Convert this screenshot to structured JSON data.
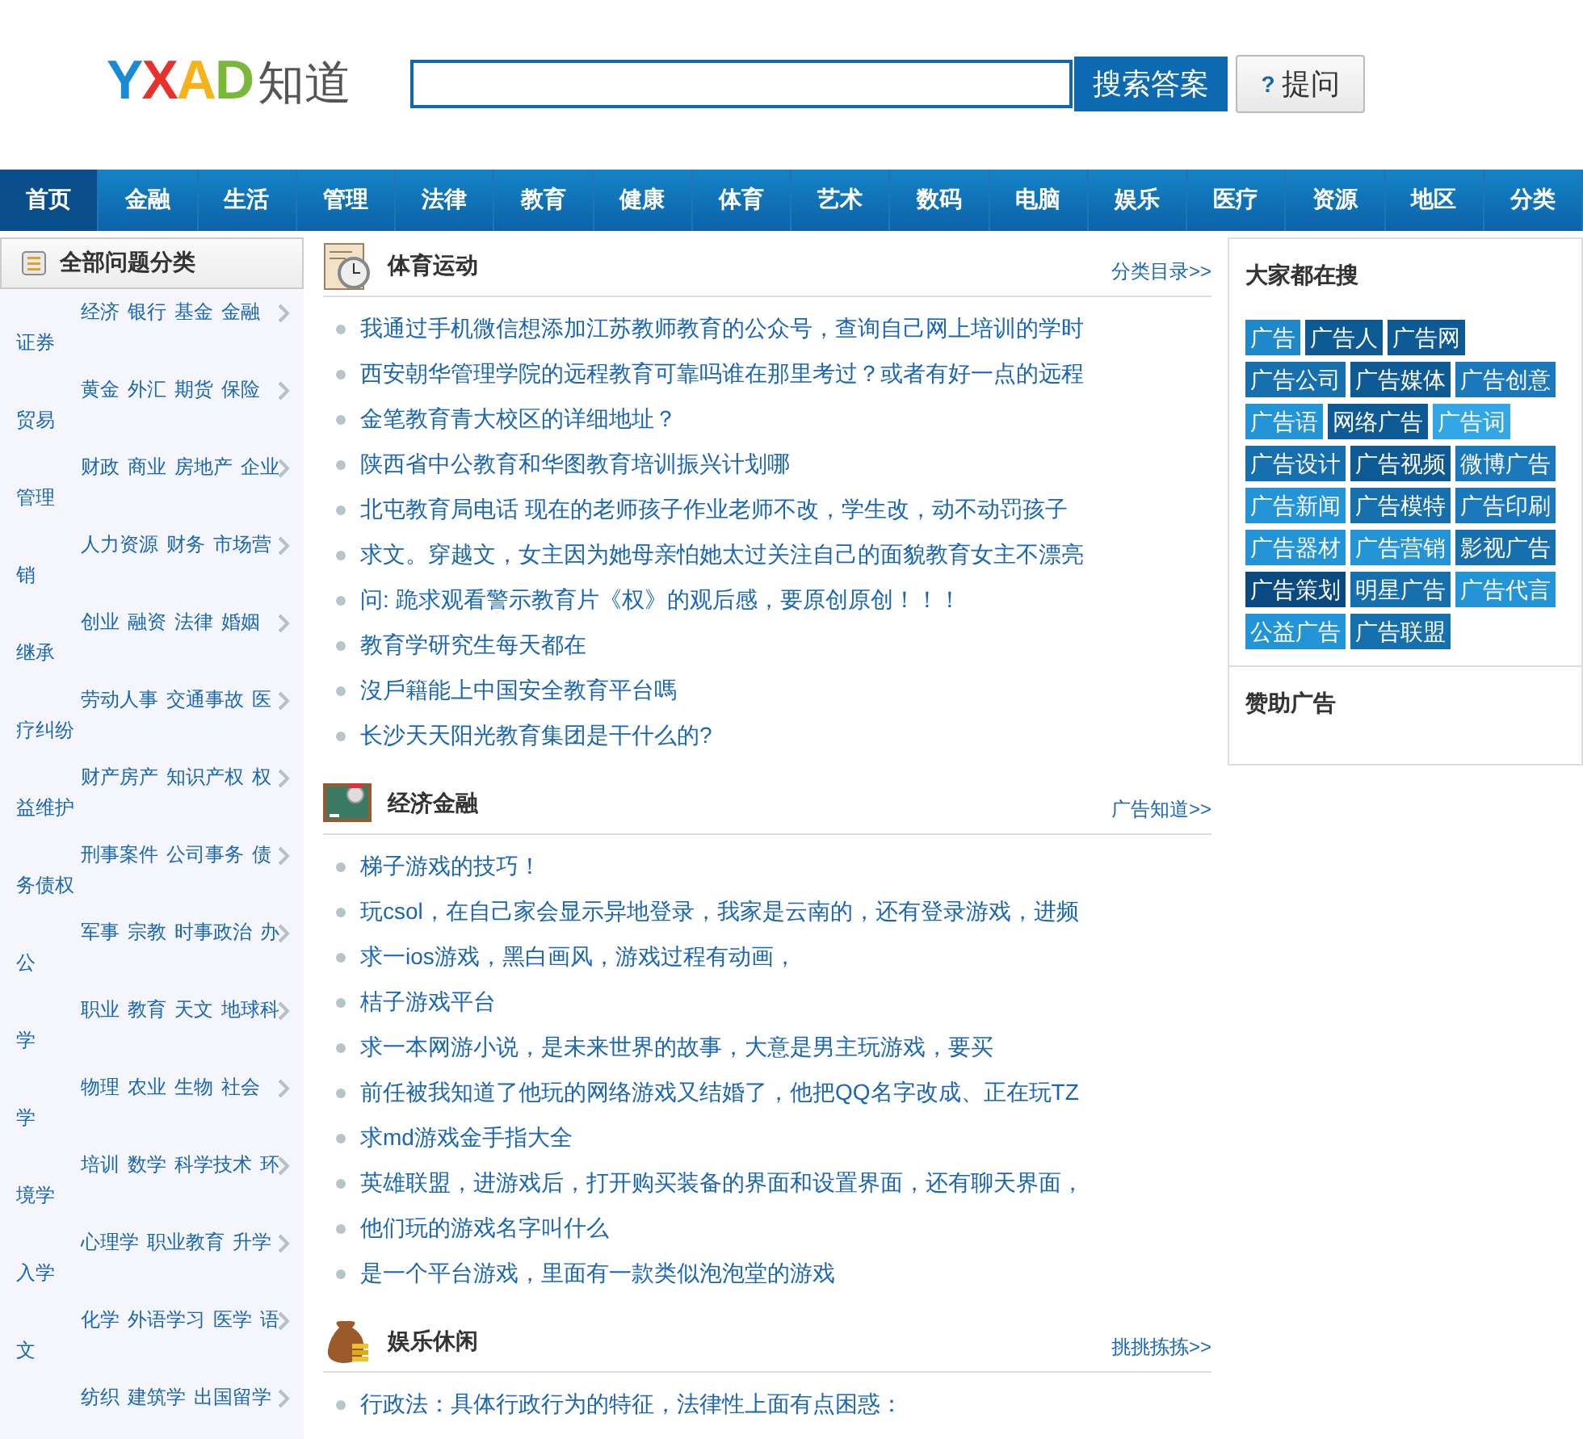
{
  "logo": {
    "letters": [
      {
        "text": "Y",
        "color": "#1b8ad6"
      },
      {
        "text": "X",
        "color": "#e8312b"
      },
      {
        "text": "A",
        "color": "#f6b21a"
      },
      {
        "text": "D",
        "color": "#7ab83a"
      }
    ],
    "suffix": "知道"
  },
  "search": {
    "button": "搜索答案",
    "ask_button": "提问",
    "ask_icon": "?"
  },
  "nav": [
    {
      "label": "首页",
      "selected": true
    },
    {
      "label": "金融",
      "selected": false
    },
    {
      "label": "生活",
      "selected": false
    },
    {
      "label": "管理",
      "selected": false
    },
    {
      "label": "法律",
      "selected": false
    },
    {
      "label": "教育",
      "selected": false
    },
    {
      "label": "健康",
      "selected": false
    },
    {
      "label": "体育",
      "selected": false
    },
    {
      "label": "艺术",
      "selected": false
    },
    {
      "label": "数码",
      "selected": false
    },
    {
      "label": "电脑",
      "selected": false
    },
    {
      "label": "娱乐",
      "selected": false
    },
    {
      "label": "医疗",
      "selected": false
    },
    {
      "label": "资源",
      "selected": false
    },
    {
      "label": "地区",
      "selected": false
    },
    {
      "label": "分类",
      "selected": false
    }
  ],
  "sidebar": {
    "title": "全部问题分类",
    "rows": [
      [
        "经济",
        "银行",
        "基金",
        "金融",
        "证券"
      ],
      [
        "黄金",
        "外汇",
        "期货",
        "保险",
        "贸易"
      ],
      [
        "财政",
        "商业",
        "房地产",
        "企业管理"
      ],
      [
        "人力资源",
        "财务",
        "市场营销"
      ],
      [
        "创业",
        "融资",
        "法律",
        "婚姻",
        "继承"
      ],
      [
        "劳动人事",
        "交通事故",
        "医疗纠纷"
      ],
      [
        "财产房产",
        "知识产权",
        "权益维护"
      ],
      [
        "刑事案件",
        "公司事务",
        "债务债权"
      ],
      [
        "军事",
        "宗教",
        "时事政治",
        "办公"
      ],
      [
        "职业",
        "教育",
        "天文",
        "地球科学"
      ],
      [
        "物理",
        "农业",
        "生物",
        "社会学"
      ],
      [
        "培训",
        "数学",
        "科学技术",
        "环境学"
      ],
      [
        "心理学",
        "职业教育",
        "升学入学"
      ],
      [
        "化学",
        "外语学习",
        "医学",
        "语文"
      ],
      [
        "纺织",
        "建筑学",
        "出国留学"
      ]
    ]
  },
  "sections": [
    {
      "kind": "clock",
      "title": "体育运动",
      "more": "分类目录>>",
      "questions": [
        "我通过手机微信想添加江苏教师教育的公众号，查询自己网上培训的学时",
        "西安朝华管理学院的远程教育可靠吗谁在那里考过？或者有好一点的远程",
        "金笔教育青大校区的详细地址？",
        "陕西省中公教育和华图教育培训振兴计划哪",
        "北屯教育局电话 现在的老师孩子作业老师不改，学生改，动不动罚孩子",
        "求文。穿越文，女主因为她母亲怕她太过关注自己的面貌教育女主不漂亮",
        "问: 跪求观看警示教育片《权》的观后感，要原创原创！！！",
        "教育学研究生每天都在",
        "沒戶籍能上中国安全教育平台嗎",
        "长沙天天阳光教育集团是干什么的?"
      ]
    },
    {
      "kind": "board",
      "title": "经济金融",
      "more": "广告知道>>",
      "questions": [
        "梯子游戏的技巧！",
        "玩csol，在自己家会显示异地登录，我家是云南的，还有登录游戏，进频",
        "求一ios游戏，黑白画风，游戏过程有动画，",
        "桔子游戏平台",
        "求一本网游小说，是未来世界的故事，大意是男主玩游戏，要买",
        "前任被我知道了他玩的网络游戏又结婚了，他把QQ名字改成、正在玩TZ",
        "求md游戏金手指大全",
        "英雄联盟，进游戏后，打开购买装备的界面和设置界面，还有聊天界面，",
        "他们玩的游戏名字叫什么",
        "是一个平台游戏，里面有一款类似泡泡堂的游戏"
      ]
    },
    {
      "kind": "moneybag",
      "title": "娱乐休闲",
      "more": "挑挑拣拣>>",
      "questions": [
        "行政法：具体行政行为的特征，法律性上面有点困惑："
      ]
    }
  ],
  "hot": {
    "title": "大家都在搜",
    "tags": [
      {
        "text": "广告",
        "color": "#1e88c8"
      },
      {
        "text": "广告人",
        "color": "#0d5a95"
      },
      {
        "text": "广告网",
        "color": "#0d5a95"
      },
      {
        "text": "广告公司",
        "color": "#1670ad"
      },
      {
        "text": "广告媒体",
        "color": "#0d5a95"
      },
      {
        "text": "广告创意",
        "color": "#1a78bb"
      },
      {
        "text": "广告语",
        "color": "#2394d6"
      },
      {
        "text": "网络广告",
        "color": "#0d5a95"
      },
      {
        "text": "广告词",
        "color": "#33a6e6"
      },
      {
        "text": "广告设计",
        "color": "#1670ad"
      },
      {
        "text": "广告视频",
        "color": "#0d5a95"
      },
      {
        "text": "微博广告",
        "color": "#1a78bb"
      },
      {
        "text": "广告新闻",
        "color": "#2394d6"
      },
      {
        "text": "广告模特",
        "color": "#1670ad"
      },
      {
        "text": "广告印刷",
        "color": "#1a78bb"
      },
      {
        "text": "广告器材",
        "color": "#2394d6"
      },
      {
        "text": "广告营销",
        "color": "#2394d6"
      },
      {
        "text": "影视广告",
        "color": "#1670ad"
      },
      {
        "text": "广告策划",
        "color": "#0a4a80"
      },
      {
        "text": "明星广告",
        "color": "#1670ad"
      },
      {
        "text": "广告代言",
        "color": "#2394d6"
      },
      {
        "text": "公益广告",
        "color": "#2394d6"
      },
      {
        "text": "广告联盟",
        "color": "#1670ad"
      }
    ]
  },
  "sponsor": {
    "title": "赞助广告"
  }
}
